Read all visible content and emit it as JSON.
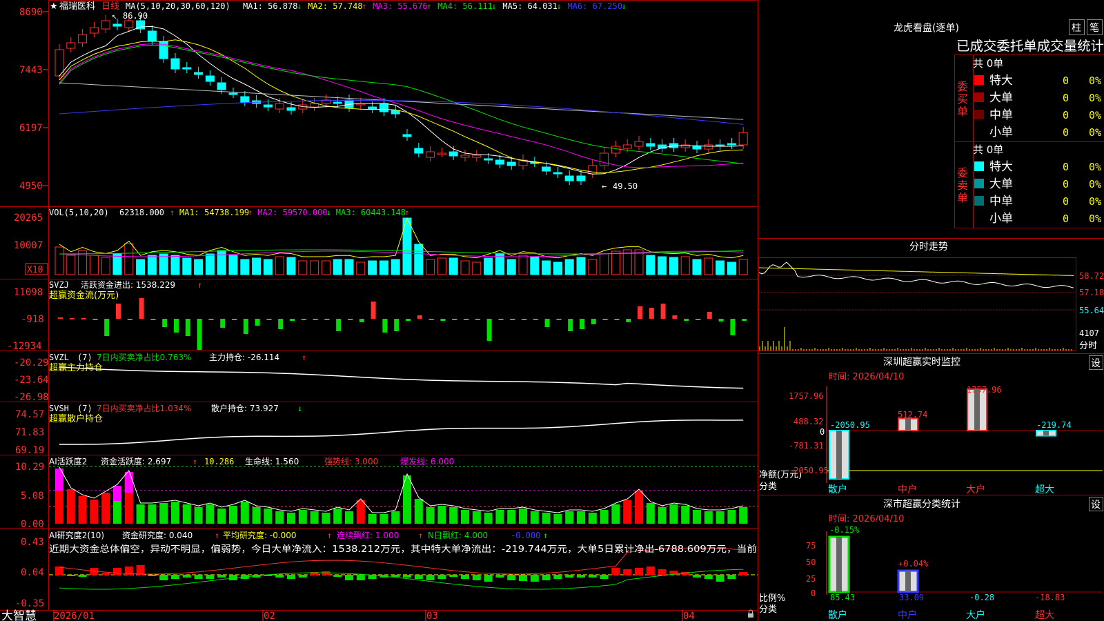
{
  "stock": {
    "star": "★",
    "name": "福瑞医科",
    "period": "日线"
  },
  "ma_line": {
    "params": "MA(5,10,20,30,60,120)",
    "items": [
      {
        "label": "MA1: 56.878",
        "arrow": "↓",
        "color": "#ffffff"
      },
      {
        "label": "MA2: 57.748",
        "arrow": "↑",
        "color": "#ffff00"
      },
      {
        "label": "MA3: 55.676",
        "arrow": "↑",
        "color": "#ff00ff"
      },
      {
        "label": "MA4: 56.111",
        "arrow": "↓",
        "color": "#00e000"
      },
      {
        "label": "MA5: 64.031",
        "arrow": "↓",
        "color": "#ffffff"
      },
      {
        "label": "MA6: 67.250",
        "arrow": "↓",
        "color": "#3a3aff"
      }
    ],
    "high_mark": "86.90",
    "low_mark": "49.50"
  },
  "price_axis": [
    "8690",
    "7443",
    "6197",
    "4950"
  ],
  "vol": {
    "header": "VOL(5,10,20)",
    "value": "62318.000",
    "arrow": "↑",
    "ma": [
      {
        "label": "MA1: 54738.199",
        "arrow": "↑",
        "color": "#ffff00"
      },
      {
        "label": "MA2: 59570.000",
        "arrow": "↓",
        "color": "#ff00ff"
      },
      {
        "label": "MA3: 60443.148",
        "arrow": "↑",
        "color": "#00e000"
      }
    ],
    "axis": [
      "20265",
      "10007"
    ],
    "unit": "X10"
  },
  "svzj": {
    "name": "SVZJ",
    "label": "活跃资金进出: 1538.229",
    "arrow": "↑",
    "sub": "超赢资金流(万元)",
    "axis": [
      "11098",
      "-918",
      "-12934"
    ]
  },
  "svzl": {
    "name": "SVZL",
    "param": "(7)",
    "green": "7日内买卖净占比0.763%",
    "label": "主力持仓: -26.114",
    "arrow": "↑",
    "sub": "超赢主力持仓",
    "axis": [
      "-20.29",
      "-23.64",
      "-26.98"
    ]
  },
  "svsh": {
    "name": "SVSH",
    "param": "(7)",
    "red": "7日内买卖净占比1.034%",
    "label": "散户持仓: 73.927",
    "arrow": "↓",
    "sub": "超赢散户持仓",
    "axis": [
      "74.57",
      "71.83",
      "69.19"
    ]
  },
  "ai1": {
    "name": "AI活跃度2",
    "a": "资金活跃度: 2.697",
    "a_arrow": "↑",
    "b": "10.286",
    "c": "生命线: 1.560",
    "d": "强势线: 3.000",
    "e": "爆发线: 6.000",
    "axis": [
      "10.29",
      "5.08",
      "0.00"
    ]
  },
  "ai2": {
    "name": "AI研究度2(10)",
    "a": "资金研究度: 0.040",
    "a_arrow": "↑",
    "b": "平均研究度: -0.000",
    "b_arrow": "↑",
    "c": "连续飘红: 1.000",
    "c_arrow": "↑",
    "d": "N日飘红: 4.000",
    "e": "-0.000",
    "f": "↑",
    "axis": [
      "0.43",
      "0.04",
      "-0.35"
    ],
    "text": "近期大资金总体偏空，异动不明显，偏弱势，今日大单净流入：1538.212万元，其中特大单净流出：-219.744万元，大单5日累计净出-6788.609万元，当前"
  },
  "date_axis": {
    "logo": "大智慧",
    "labels": [
      "2026/01",
      "02",
      "03",
      "04"
    ]
  },
  "right": {
    "title": "龙虎看盘(逐单)",
    "btn1": "柱",
    "btn2": "笔",
    "tabs": "已成交委托单成交量统计",
    "buy": {
      "side": "委买单",
      "total": "共 0单",
      "rows": [
        {
          "label": "特大",
          "v": "0",
          "p": "0%",
          "color": "#ff0000"
        },
        {
          "label": "大单",
          "v": "0",
          "p": "0%",
          "color": "#a00000"
        },
        {
          "label": "中单",
          "v": "0",
          "p": "0%",
          "color": "#700000"
        },
        {
          "label": "小单",
          "v": "0",
          "p": "0%",
          "color": "#000000"
        }
      ]
    },
    "sell": {
      "side": "委卖单",
      "total": "共 0单",
      "rows": [
        {
          "label": "特大",
          "v": "0",
          "p": "0%",
          "color": "#00ffff"
        },
        {
          "label": "大单",
          "v": "0",
          "p": "0%",
          "color": "#009898"
        },
        {
          "label": "中单",
          "v": "0",
          "p": "0%",
          "color": "#007070"
        },
        {
          "label": "小单",
          "v": "0",
          "p": "0%",
          "color": "#000000"
        }
      ]
    },
    "intraday": {
      "title": "分时走势",
      "axis": [
        "58.72",
        "57.18",
        "55.64",
        "4107"
      ],
      "foot": "分时"
    },
    "monitor": {
      "title": "深圳超赢实时监控",
      "btn": "设",
      "time": "时间: 2026/04/10",
      "axis": [
        "1757.96",
        "488.32",
        "0",
        "-781.31",
        "-2050.95"
      ],
      "ylabel": "净额(万元)",
      "xlabel": "分类",
      "bars": [
        {
          "cat": "散户",
          "v": "-2050.95",
          "val": -2050.95
        },
        {
          "cat": "中户",
          "v": "512.74",
          "val": 512.74
        },
        {
          "cat": "大户",
          "v": "1757.96",
          "val": 1757.96
        },
        {
          "cat": "超大",
          "v": "-219.74",
          "val": -219.74
        }
      ]
    },
    "classify": {
      "title": "深市超赢分类统计",
      "btn": "设",
      "time": "时间: 2026/04/10",
      "axis": [
        "75",
        "50",
        "25",
        "0"
      ],
      "ylabel": "比例%",
      "xlabel": "分类",
      "bars": [
        {
          "cat": "散户",
          "top": "-0.15%",
          "bottom": "85.43",
          "val": 85.43
        },
        {
          "cat": "中户",
          "top": "+0.04%",
          "bottom": "33.09",
          "val": 33.09
        },
        {
          "cat": "大户",
          "top": "",
          "bottom": "-0.28",
          "val": 0
        },
        {
          "cat": "超大",
          "top": "",
          "bottom": "-18.83",
          "val": 0
        }
      ]
    }
  }
}
